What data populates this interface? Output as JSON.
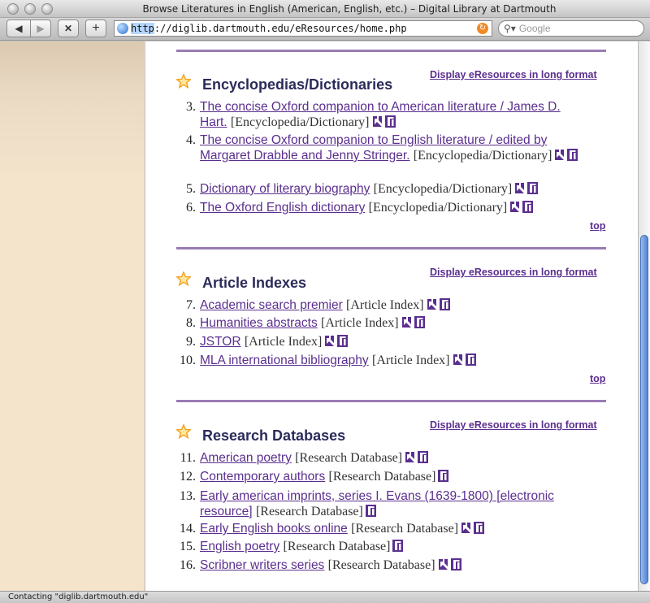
{
  "window": {
    "title": "Browse Literatures in English (American, English, etc.) – Digital Library at Dartmouth",
    "url_prefix": "http",
    "url_rest": "://diglib.dartmouth.edu/eResources/home.php",
    "search_placeholder": "Google",
    "status": "Contacting \"diglib.dartmouth.edu\""
  },
  "toolbar": {
    "back_glyph": "◀",
    "forward_glyph": "▶",
    "stop_glyph": "✕",
    "add_glyph": "+"
  },
  "sections": [
    {
      "title": "Encyclopedias/Dictionaries",
      "long_format_label": "Display eResources in long format",
      "top_label": "top",
      "entries": [
        {
          "num": "3.",
          "link": "The concise Oxford companion to American literature / James D. Hart.",
          "type": "[Encyclopedia/Dictionary]",
          "icons": [
            "full-record-icon",
            "holdings-icon"
          ]
        },
        {
          "num": "4.",
          "link": "The concise Oxford companion to English literature / edited by Margaret Drabble and Jenny Stringer.",
          "type": "[Encyclopedia/Dictionary]",
          "icons": [
            "full-record-icon",
            "holdings-icon"
          ]
        },
        {
          "num": "5.",
          "link": "Dictionary of literary biography",
          "type": "[Encyclopedia/Dictionary]",
          "icons": [
            "full-record-icon",
            "holdings-icon"
          ]
        },
        {
          "num": "6.",
          "link": "The Oxford English dictionary",
          "type": "[Encyclopedia/Dictionary]",
          "icons": [
            "full-record-icon",
            "holdings-icon"
          ]
        }
      ]
    },
    {
      "title": "Article Indexes",
      "long_format_label": "Display eResources in long format",
      "top_label": "top",
      "entries": [
        {
          "num": "7.",
          "link": "Academic search premier",
          "type": "[Article Index]",
          "icons": [
            "full-record-icon",
            "holdings-icon"
          ]
        },
        {
          "num": "8.",
          "link": "Humanities abstracts",
          "type": "[Article Index]",
          "icons": [
            "full-record-icon",
            "holdings-icon"
          ]
        },
        {
          "num": "9.",
          "link": "JSTOR",
          "type": "[Article Index]",
          "icons": [
            "full-record-icon",
            "holdings-icon"
          ]
        },
        {
          "num": "10.",
          "link": "MLA international bibliography",
          "type": "[Article Index]",
          "icons": [
            "full-record-icon",
            "holdings-icon"
          ]
        }
      ]
    },
    {
      "title": "Research Databases",
      "long_format_label": "Display eResources in long format",
      "top_label": "",
      "entries": [
        {
          "num": "11.",
          "link": "American poetry",
          "type": "[Research Database]",
          "icons": [
            "full-record-icon",
            "holdings-icon"
          ]
        },
        {
          "num": "12.",
          "link": "Contemporary authors",
          "type": "[Research Database]",
          "icons": [
            "holdings-icon"
          ]
        },
        {
          "num": "13.",
          "link": "Early american imprints, series I. Evans (1639-1800) [electronic resource]",
          "type": "[Research Database]",
          "icons": [
            "holdings-icon"
          ]
        },
        {
          "num": "14.",
          "link": "Early English books online",
          "type": "[Research Database]",
          "icons": [
            "full-record-icon",
            "holdings-icon"
          ]
        },
        {
          "num": "15.",
          "link": "English poetry",
          "type": "[Research Database]",
          "icons": [
            "holdings-icon"
          ]
        },
        {
          "num": "16.",
          "link": "Scribner writers series",
          "type": "[Research Database]",
          "icons": [
            "full-record-icon",
            "holdings-icon"
          ]
        }
      ]
    }
  ],
  "colors": {
    "link": "#5b2f8f",
    "rule": "#9a7bb4",
    "heading": "#2b2b5a",
    "star": "#f2a21d"
  }
}
